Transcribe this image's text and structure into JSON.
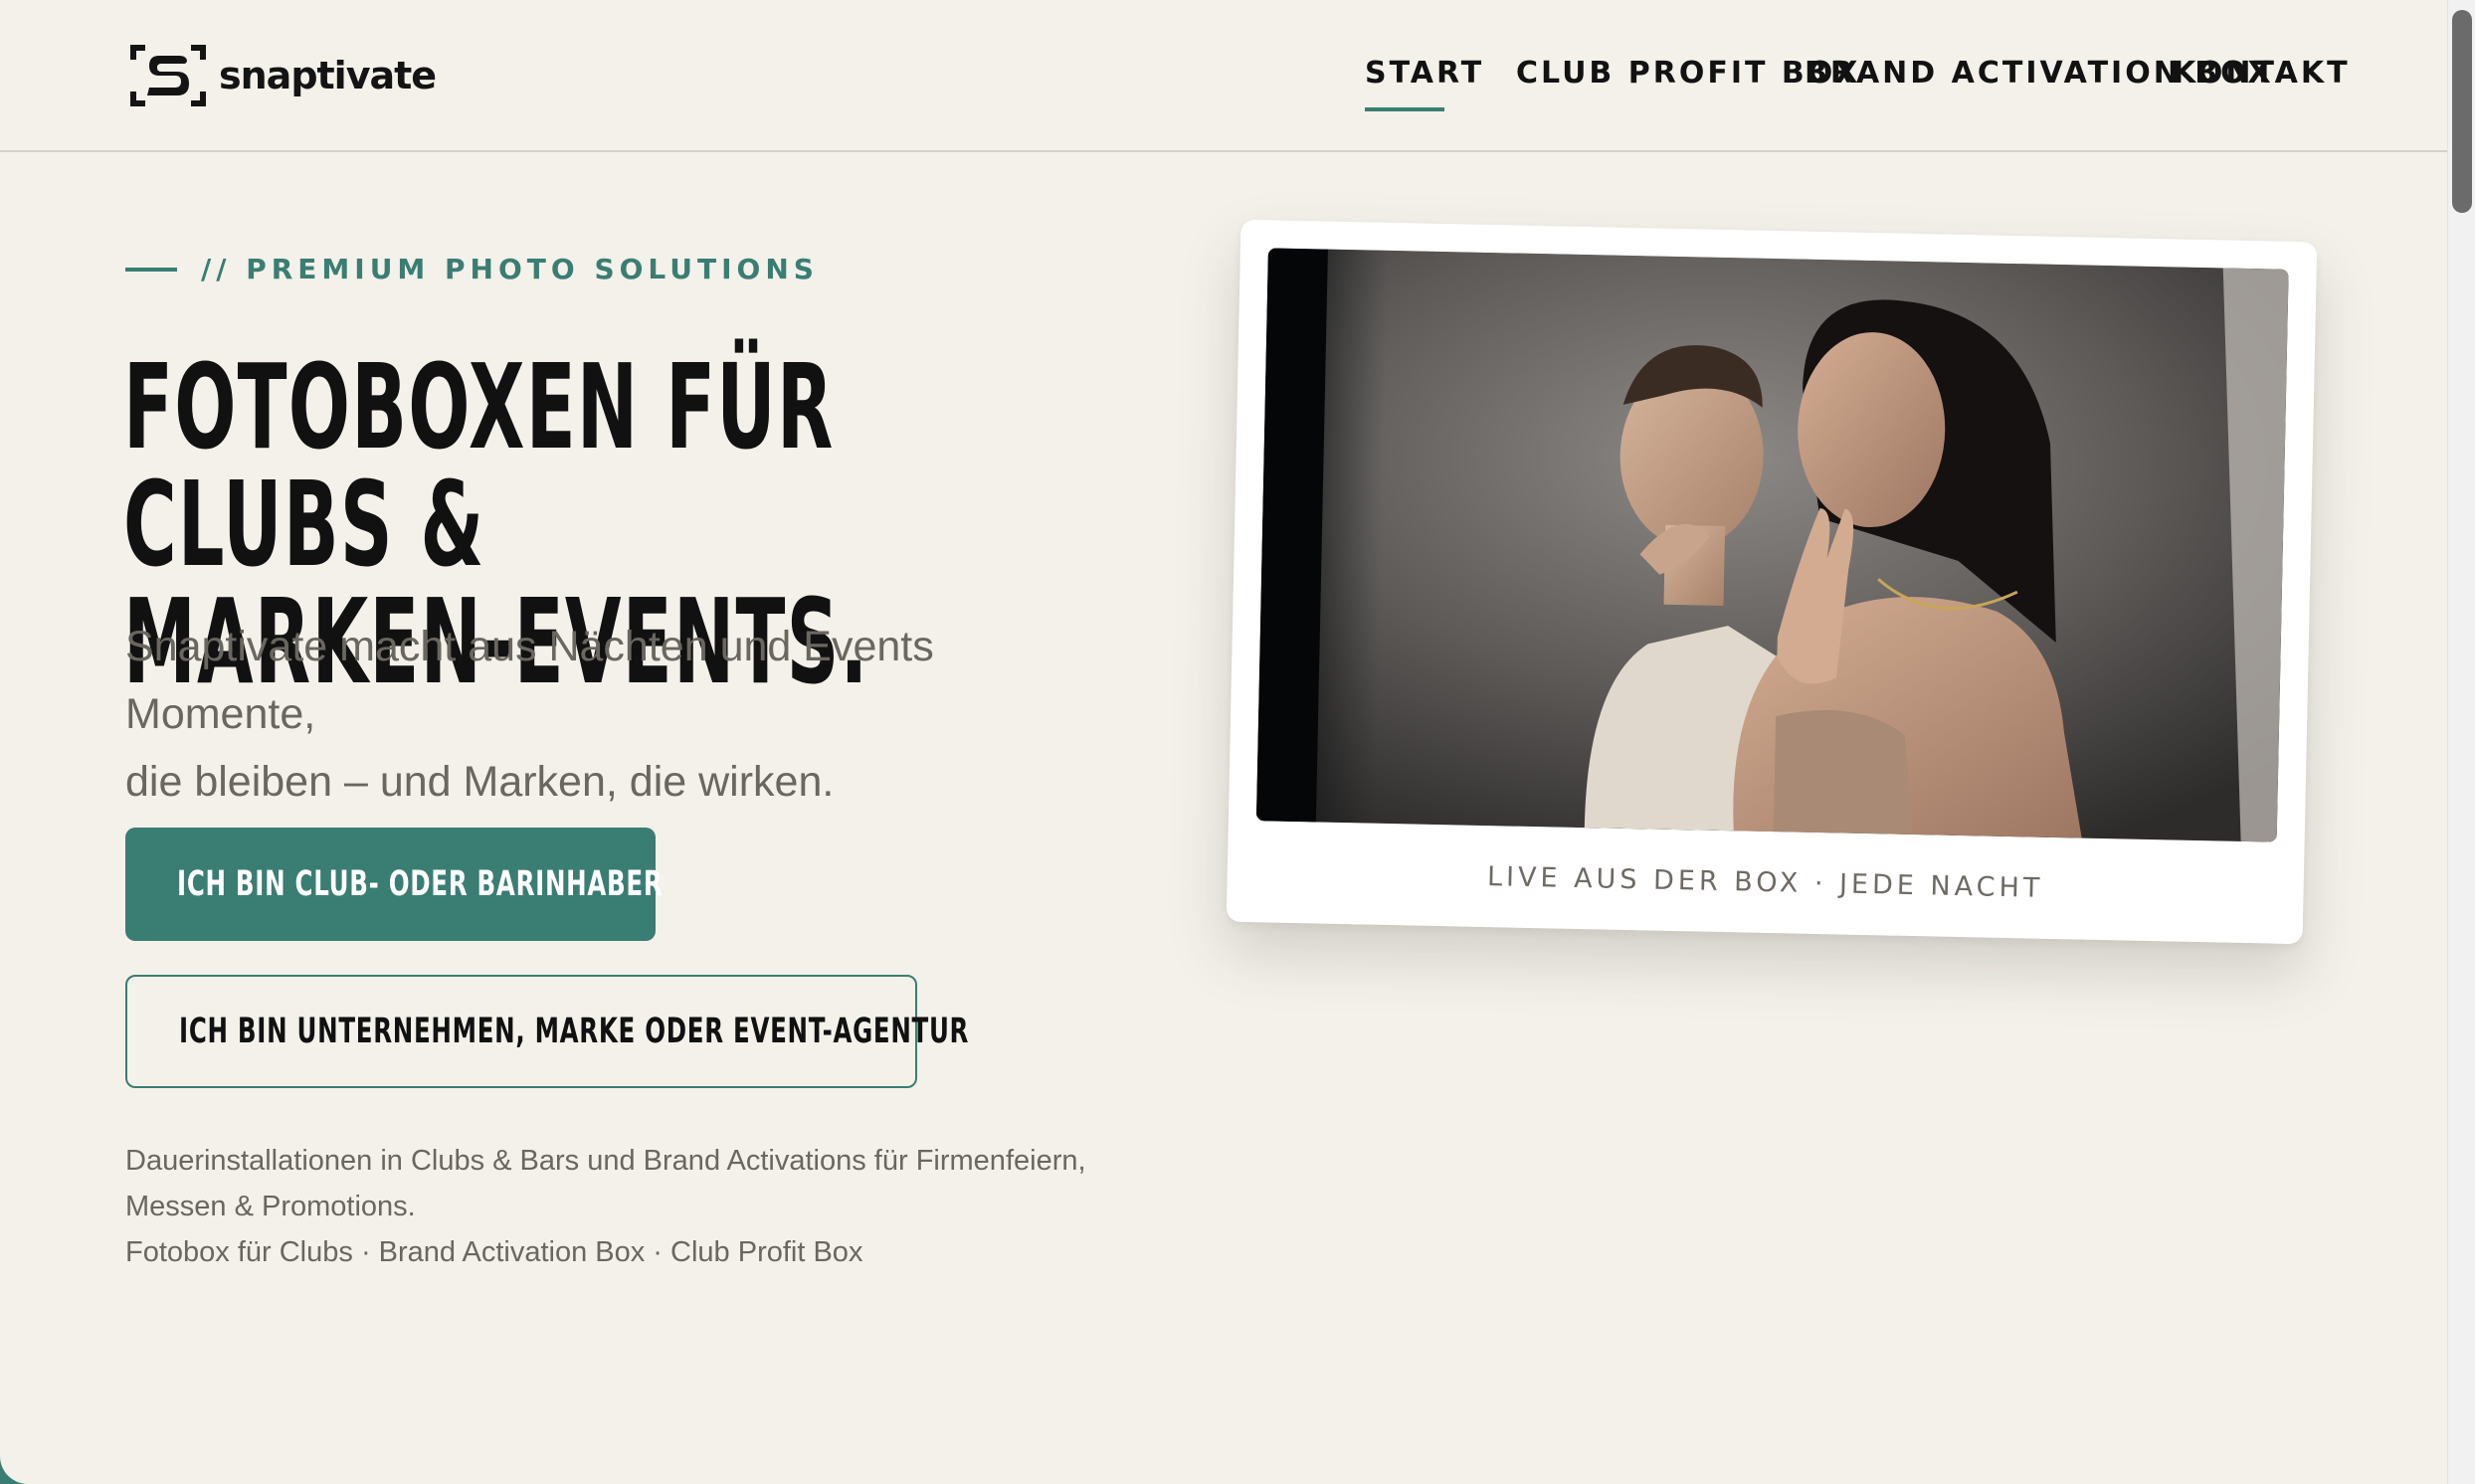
{
  "brand": {
    "name": "snaptivate",
    "logo_icon": "s-bracket-logo-icon"
  },
  "nav": {
    "items": [
      {
        "label": "START",
        "active": true
      },
      {
        "label": "CLUB PROFIT BOX",
        "active": false
      },
      {
        "label": "BRAND ACTIVATION BOX",
        "active": false
      },
      {
        "label": "KONTAKT",
        "active": false
      }
    ]
  },
  "hero": {
    "eyebrow": "// PREMIUM PHOTO SOLUTIONS",
    "headline_line1": "FOTOBOXEN FÜR CLUBS &",
    "headline_line2": "MARKEN-EVENTS.",
    "subtitle_line1": "Snaptivate macht aus Nächten und Events Momente,",
    "subtitle_line2": "die bleiben – und Marken, die wirken.",
    "primary_cta": "ICH BIN CLUB- ODER BARINHABER",
    "secondary_cta": "ICH BIN UNTERNEHMEN, MARKE ODER EVENT-AGENTUR",
    "description_line1": "Dauerinstallationen in Clubs & Bars und Brand Activations für Firmenfeiern,",
    "description_line2": "Messen & Promotions.",
    "description_line3": "Fotobox für Clubs · Brand Activation Box · Club Profit Box"
  },
  "photo_card": {
    "caption": "LIVE AUS DER BOX · JEDE NACHT"
  },
  "colors": {
    "accent": "#3a7d73",
    "background": "#f3f1ea",
    "text_dark": "#111111",
    "text_muted": "#6a6660"
  }
}
